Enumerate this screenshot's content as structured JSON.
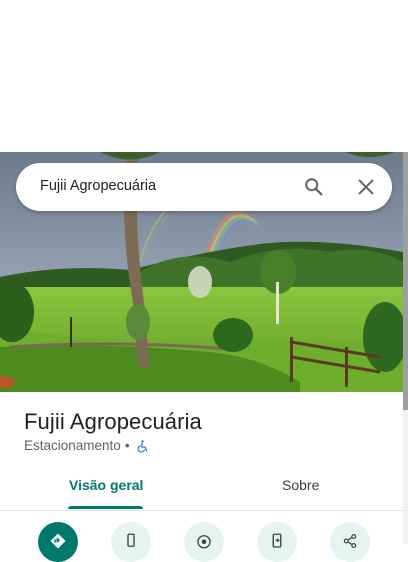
{
  "search": {
    "query": "Fujii Agropecuária"
  },
  "place": {
    "name": "Fujii Agropecuária",
    "category": "Estacionamento",
    "separator": "•"
  },
  "tabs": [
    {
      "label": "Visão geral",
      "selected": true
    },
    {
      "label": "Sobre",
      "selected": false
    }
  ],
  "actions": [
    {
      "icon": "directions-icon"
    },
    {
      "icon": "phone-icon"
    },
    {
      "icon": "nearby-icon"
    },
    {
      "icon": "send-to-phone-icon"
    },
    {
      "icon": "share-icon"
    }
  ],
  "colors": {
    "accent": "#00796b",
    "accessible_icon": "#1a73e8"
  }
}
